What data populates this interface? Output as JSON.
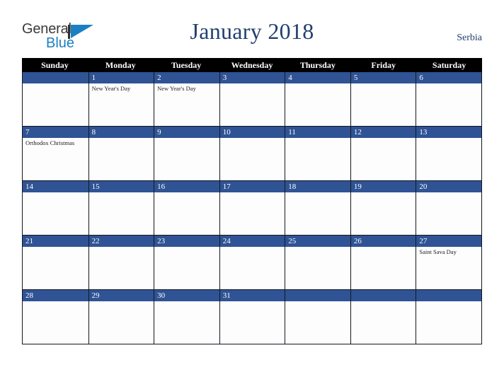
{
  "brand": {
    "line1": "General",
    "line2": "Blue",
    "mark": "triangle-icon"
  },
  "header": {
    "title": "January 2018",
    "locale": "Serbia"
  },
  "calendar": {
    "weekdays": [
      "Sunday",
      "Monday",
      "Tuesday",
      "Wednesday",
      "Thursday",
      "Friday",
      "Saturday"
    ],
    "accent_color": "#2f5394",
    "header_color": "#000000",
    "weeks": [
      [
        {
          "date": "",
          "events": []
        },
        {
          "date": "1",
          "events": [
            "New Year's Day"
          ]
        },
        {
          "date": "2",
          "events": [
            "New Year's Day"
          ]
        },
        {
          "date": "3",
          "events": []
        },
        {
          "date": "4",
          "events": []
        },
        {
          "date": "5",
          "events": []
        },
        {
          "date": "6",
          "events": []
        }
      ],
      [
        {
          "date": "7",
          "events": [
            "Orthodox Christmas"
          ]
        },
        {
          "date": "8",
          "events": []
        },
        {
          "date": "9",
          "events": []
        },
        {
          "date": "10",
          "events": []
        },
        {
          "date": "11",
          "events": []
        },
        {
          "date": "12",
          "events": []
        },
        {
          "date": "13",
          "events": []
        }
      ],
      [
        {
          "date": "14",
          "events": []
        },
        {
          "date": "15",
          "events": []
        },
        {
          "date": "16",
          "events": []
        },
        {
          "date": "17",
          "events": []
        },
        {
          "date": "18",
          "events": []
        },
        {
          "date": "19",
          "events": []
        },
        {
          "date": "20",
          "events": []
        }
      ],
      [
        {
          "date": "21",
          "events": []
        },
        {
          "date": "22",
          "events": []
        },
        {
          "date": "23",
          "events": []
        },
        {
          "date": "24",
          "events": []
        },
        {
          "date": "25",
          "events": []
        },
        {
          "date": "26",
          "events": []
        },
        {
          "date": "27",
          "events": [
            "Saint Sava Day"
          ]
        }
      ],
      [
        {
          "date": "28",
          "events": []
        },
        {
          "date": "29",
          "events": []
        },
        {
          "date": "30",
          "events": []
        },
        {
          "date": "31",
          "events": []
        },
        {
          "date": "",
          "events": []
        },
        {
          "date": "",
          "events": []
        },
        {
          "date": "",
          "events": []
        }
      ]
    ]
  }
}
